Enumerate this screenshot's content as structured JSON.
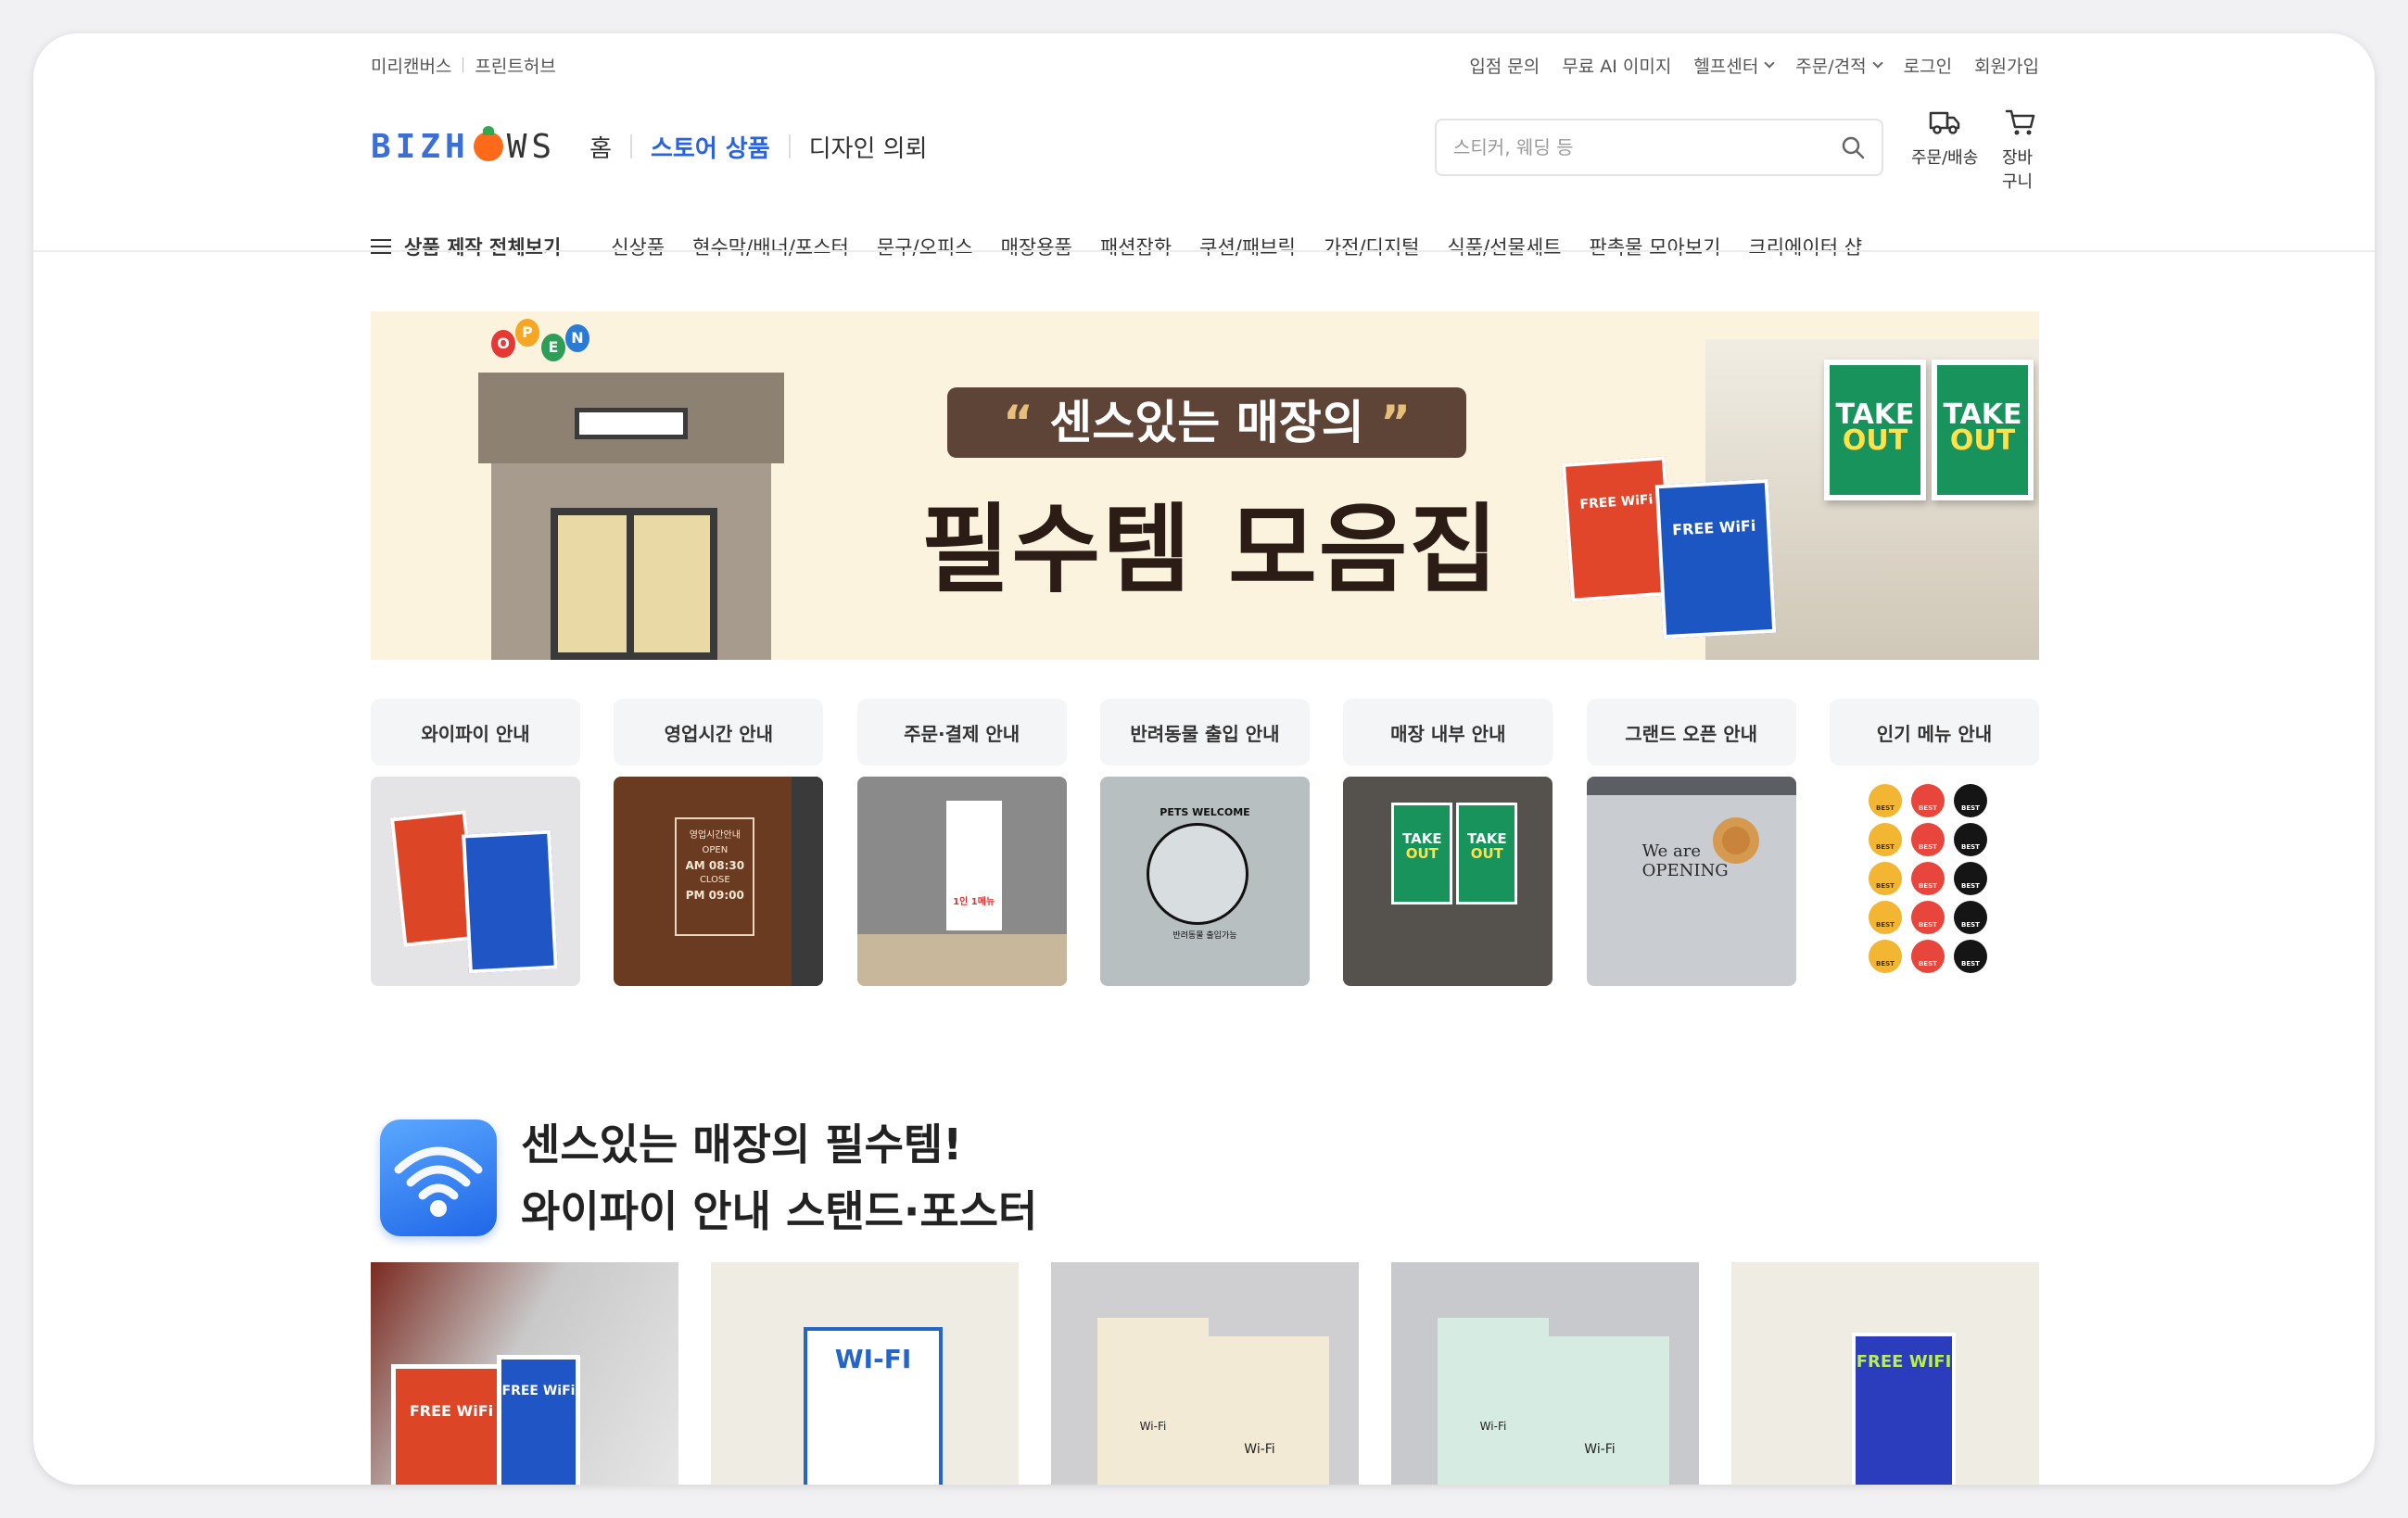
{
  "util_links_left": [
    "미리캔버스",
    "프린트허브"
  ],
  "util_links_right": [
    {
      "label": "입점 문의",
      "dropdown": false
    },
    {
      "label": "무료 AI 이미지",
      "dropdown": false
    },
    {
      "label": "헬프센터",
      "dropdown": true
    },
    {
      "label": "주문/견적",
      "dropdown": true
    },
    {
      "label": "로그인",
      "dropdown": false
    },
    {
      "label": "회원가입",
      "dropdown": false
    }
  ],
  "logo": {
    "left": "BIZH",
    "right": "WS"
  },
  "top_nav": {
    "home": "홈",
    "store": "스토어 상품",
    "design": "디자인 의뢰"
  },
  "search": {
    "placeholder": "스티커, 웨딩 등"
  },
  "header_icons": {
    "orders": "주문/배송",
    "cart": "장바구니"
  },
  "category_nav": {
    "all": "상품 제작 전체보기",
    "items": [
      "신상품",
      "현수막/배너/포스터",
      "문구/오피스",
      "매장용품",
      "패션잡화",
      "쿠션/패브릭",
      "가전/디지털",
      "식품/선물세트",
      "판촉물 모아보기",
      "크리에이터 샵"
    ]
  },
  "banner": {
    "balloons": [
      "O",
      "P",
      "E",
      "N"
    ],
    "quote_open": "“",
    "quote_text": "센스있는 매장의",
    "quote_close": "”",
    "title": "필수템 모음집",
    "takeout_word": "TAKE",
    "takeout_word2": "OUT",
    "wifi_text": "FREE WiFi"
  },
  "categories": [
    {
      "label": "와이파이 안내"
    },
    {
      "label": "영업시간 안내"
    },
    {
      "label": "주문·결제 안내"
    },
    {
      "label": "반려동물 출입 안내"
    },
    {
      "label": "매장 내부 안내"
    },
    {
      "label": "그랜드 오픈 안내"
    },
    {
      "label": "인기 메뉴 안내"
    }
  ],
  "category_thumbs": {
    "hours_title": "영업시간안내",
    "hours_open": "OPEN",
    "hours_open_time": "AM 08:30",
    "hours_close": "CLOSE",
    "hours_close_time": "PM 09:00",
    "order_text": "1인 1메뉴",
    "pets_text": "PETS WELCOME",
    "pets_sub": "반려동물 출입가능",
    "opening_text": "We are OPENING",
    "best_badge": "BEST"
  },
  "section": {
    "line1": "센스있는 매장의 필수템!",
    "line2": "와이파이 안내 스탠드·포스터"
  },
  "products": [
    {
      "text": "FREE WiFi"
    },
    {
      "text": "WI-FI"
    },
    {
      "text": "Wi-Fi"
    },
    {
      "text": "Wi-Fi"
    },
    {
      "text": "FREE WIFI"
    }
  ],
  "colors": {
    "accent": "#2a63e0",
    "banner_bg": "#fbf3dd",
    "takeout_green": "#18935b"
  }
}
